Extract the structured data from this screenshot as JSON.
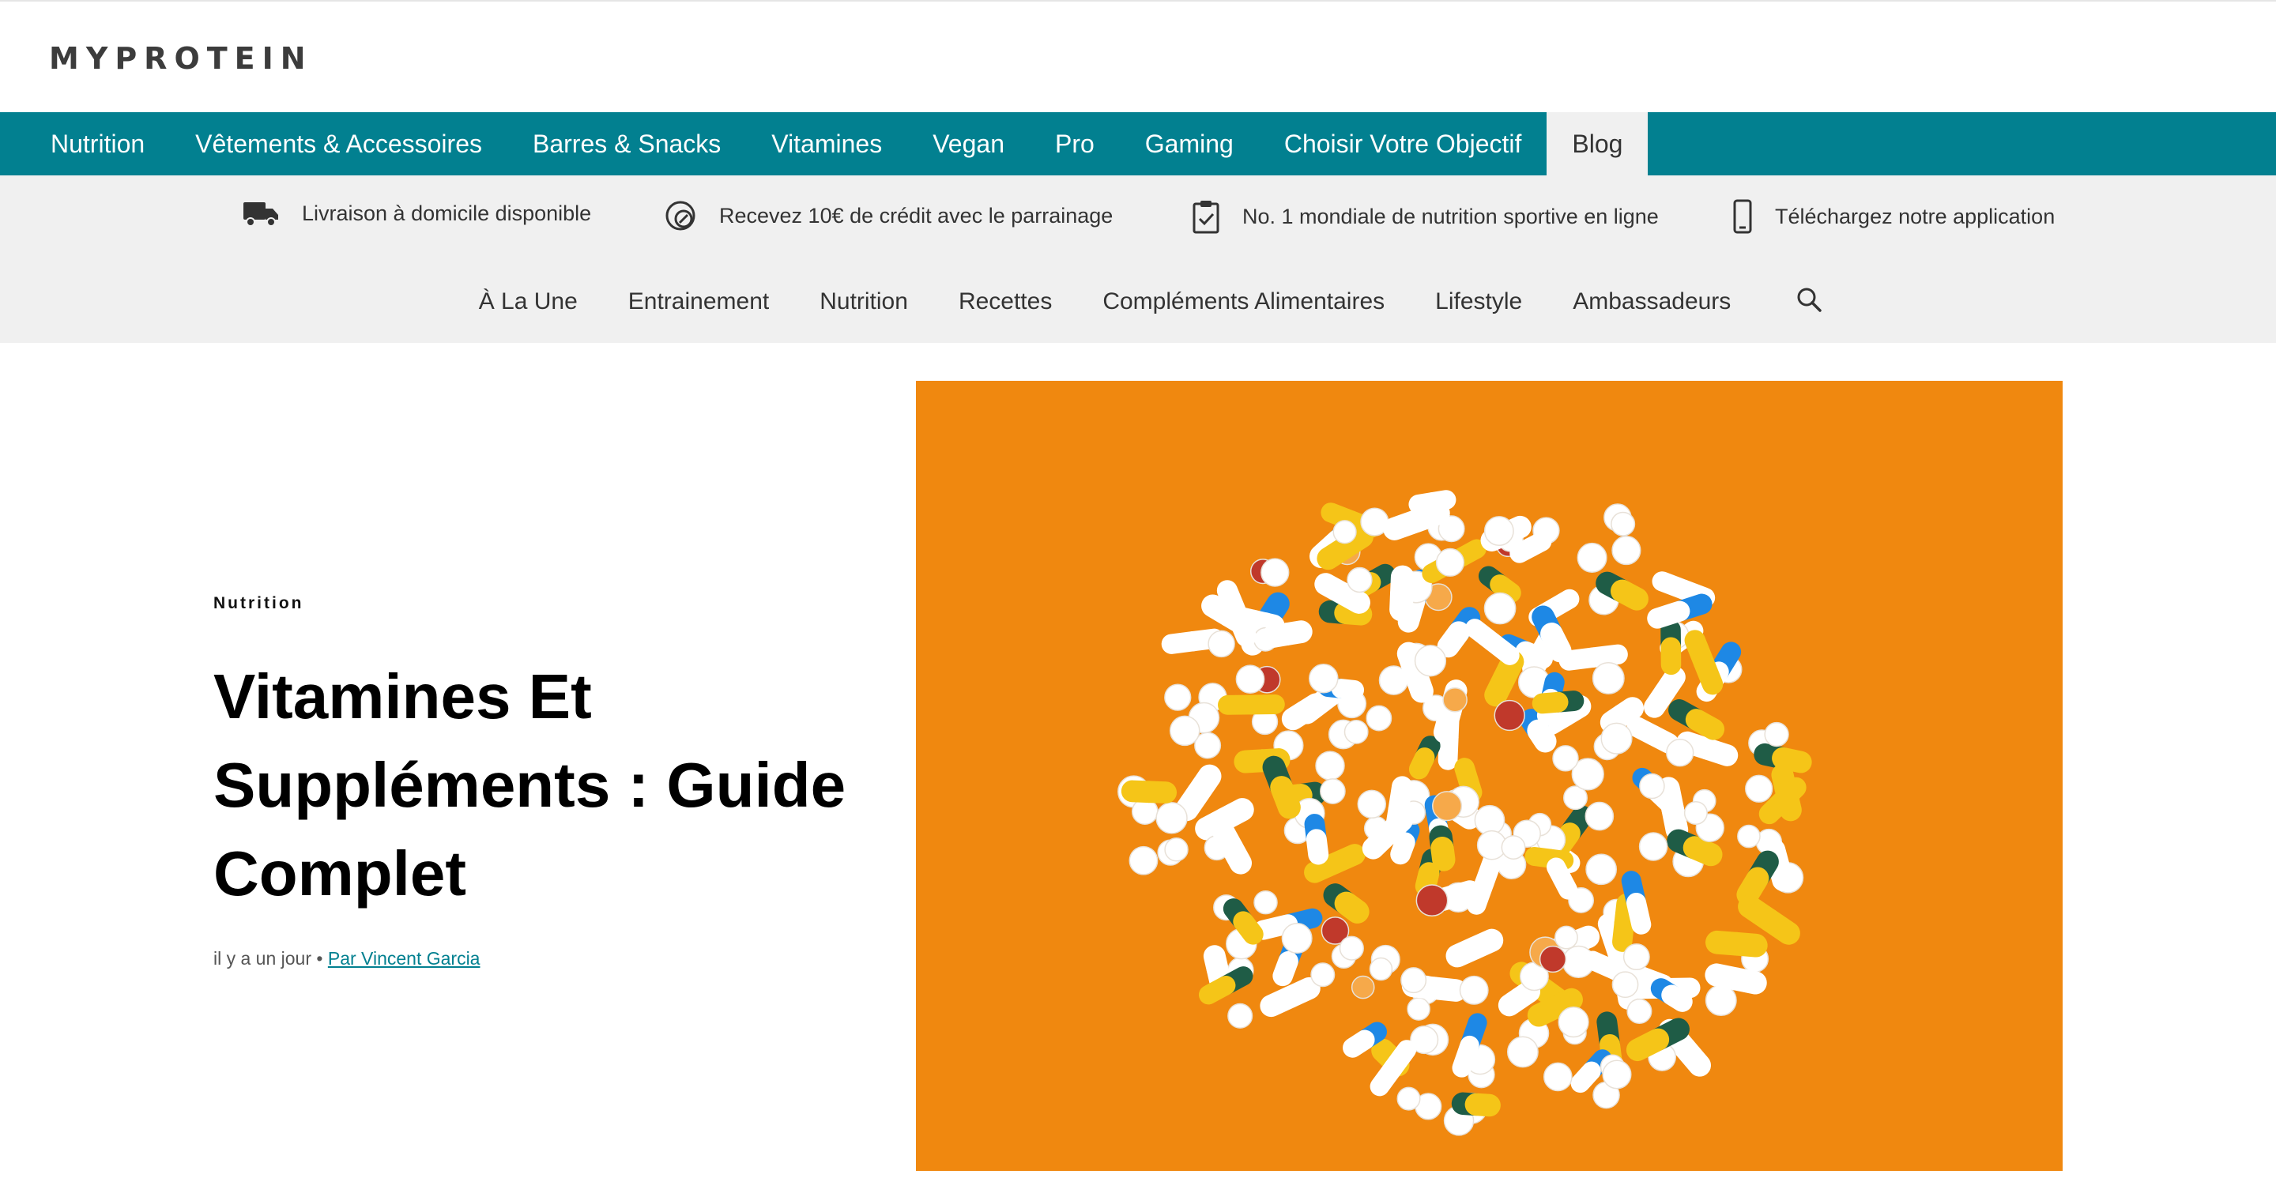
{
  "brand": {
    "logo_text": "MYPROTEIN"
  },
  "main_nav": {
    "items": [
      "Nutrition",
      "Vêtements & Accessoires",
      "Barres & Snacks",
      "Vitamines",
      "Vegan",
      "Pro",
      "Gaming",
      "Choisir Votre Objectif",
      "Blog"
    ],
    "active": "Blog"
  },
  "info_strip": {
    "delivery": "Livraison à domicile disponible",
    "referral": "Recevez 10€ de crédit avec le parrainage",
    "ranking": "No. 1 mondiale de nutrition sportive en ligne",
    "app": "Téléchargez notre application"
  },
  "blog_nav": {
    "items": [
      "À La Une",
      "Entrainement",
      "Nutrition",
      "Recettes",
      "Compléments Alimentaires",
      "Lifestyle",
      "Ambassadeurs"
    ]
  },
  "article": {
    "category": "Nutrition",
    "title": "Vitamines Et Suppléments : Guide Complet",
    "date": "il y a un jour",
    "separator": "•",
    "author": "Par Vincent Garcia"
  },
  "colors": {
    "brand_teal": "#028090",
    "hero_orange": "#f0880f",
    "strip_grey": "#f0f0f0"
  },
  "icons": [
    "truck-icon",
    "referral-icon",
    "clipboard-check-icon",
    "phone-icon",
    "search-icon"
  ]
}
